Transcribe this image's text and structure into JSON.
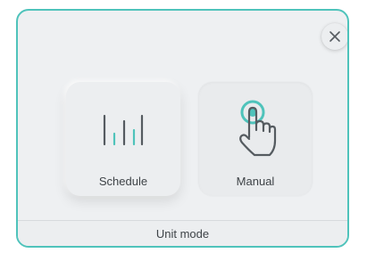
{
  "dialog": {
    "close_icon": "close-icon",
    "accent_color": "#4fc3bb"
  },
  "modes": {
    "schedule": {
      "label": "Schedule",
      "icon": "schedule-bars-icon"
    },
    "manual": {
      "label": "Manual",
      "icon": "hand-pointer-icon"
    }
  },
  "footer": {
    "title": "Unit mode"
  }
}
